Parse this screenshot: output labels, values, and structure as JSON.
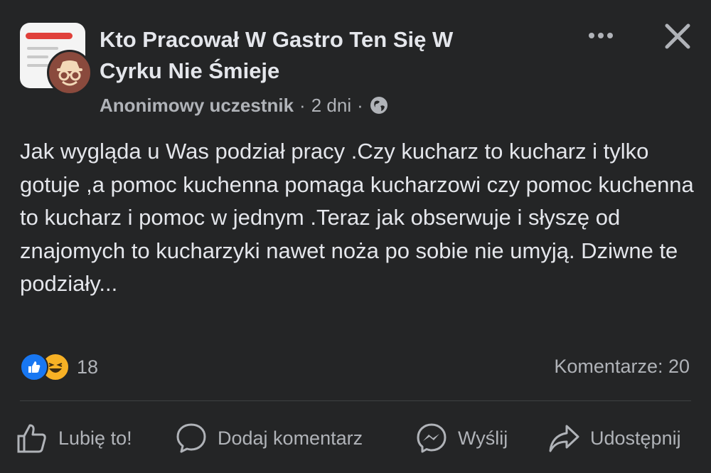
{
  "post": {
    "group_name": "Kto Pracował W Gastro Ten Się W Cyrku Nie Śmieje",
    "author": "Anonimowy uczestnik",
    "separator": "·",
    "time": "2 dni",
    "text": "Jak wygląda u Was podział pracy .Czy kucharz to kucharz i tylko gotuje ,a pomoc kuchenna pomaga kucharzowi czy pomoc kuchenna to kucharz i pomoc w jednym .Teraz jak obserwuje i słyszę od znajomych to kucharzyki nawet noża po sobie nie umyją. Dziwne te podziały...",
    "privacy_icon": "globe-icon"
  },
  "reactions": {
    "icons": [
      "like-icon",
      "haha-icon"
    ],
    "count": "18",
    "comments_label": "Komentarze: 20"
  },
  "actions": {
    "like": "Lubię to!",
    "comment": "Dodaj komentarz",
    "send": "Wyślij",
    "share": "Udostępnij"
  },
  "colors": {
    "background": "#242526",
    "text": "#e4e6eb",
    "secondary": "#b0b3b8",
    "like_blue": "#1877f2",
    "haha_yellow": "#f7b125"
  }
}
